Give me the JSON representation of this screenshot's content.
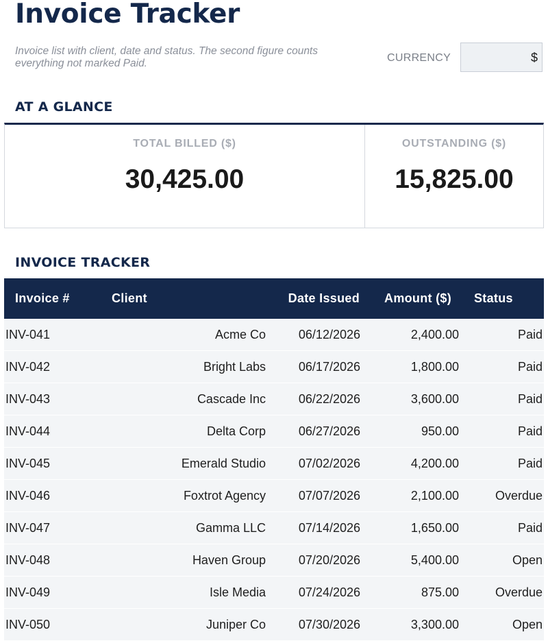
{
  "header": {
    "title": "Invoice Tracker",
    "subtitle": "Invoice list with client, date and status. The second figure counts everything not marked Paid.",
    "currency_label": "CURRENCY",
    "currency_value": "$"
  },
  "glance": {
    "section_title": "AT A GLANCE",
    "total_billed_label": "TOTAL BILLED ($)",
    "total_billed_value": "30,425.00",
    "outstanding_label": "OUTSTANDING ($)",
    "outstanding_value": "15,825.00"
  },
  "tracker": {
    "section_title": "INVOICE TRACKER",
    "columns": [
      "Invoice #",
      "Client",
      "Date Issued",
      "Amount ($)",
      "Status"
    ],
    "rows": [
      {
        "invoice": "INV-041",
        "client": "Acme Co",
        "date": "06/12/2026",
        "amount": "2,400.00",
        "status": "Paid"
      },
      {
        "invoice": "INV-042",
        "client": "Bright Labs",
        "date": "06/17/2026",
        "amount": "1,800.00",
        "status": "Paid"
      },
      {
        "invoice": "INV-043",
        "client": "Cascade Inc",
        "date": "06/22/2026",
        "amount": "3,600.00",
        "status": "Paid"
      },
      {
        "invoice": "INV-044",
        "client": "Delta Corp",
        "date": "06/27/2026",
        "amount": "950.00",
        "status": "Paid"
      },
      {
        "invoice": "INV-045",
        "client": "Emerald Studio",
        "date": "07/02/2026",
        "amount": "4,200.00",
        "status": "Paid"
      },
      {
        "invoice": "INV-046",
        "client": "Foxtrot Agency",
        "date": "07/07/2026",
        "amount": "2,100.00",
        "status": "Overdue"
      },
      {
        "invoice": "INV-047",
        "client": "Gamma LLC",
        "date": "07/14/2026",
        "amount": "1,650.00",
        "status": "Paid"
      },
      {
        "invoice": "INV-048",
        "client": "Haven Group",
        "date": "07/20/2026",
        "amount": "5,400.00",
        "status": "Open"
      },
      {
        "invoice": "INV-049",
        "client": "Isle Media",
        "date": "07/24/2026",
        "amount": "875.00",
        "status": "Overdue"
      },
      {
        "invoice": "INV-050",
        "client": "Juniper Co",
        "date": "07/30/2026",
        "amount": "3,300.00",
        "status": "Open"
      }
    ]
  },
  "colors": {
    "navy": "#14284b",
    "row_background": "#f3f5f7",
    "muted_text": "#a8acb4"
  }
}
